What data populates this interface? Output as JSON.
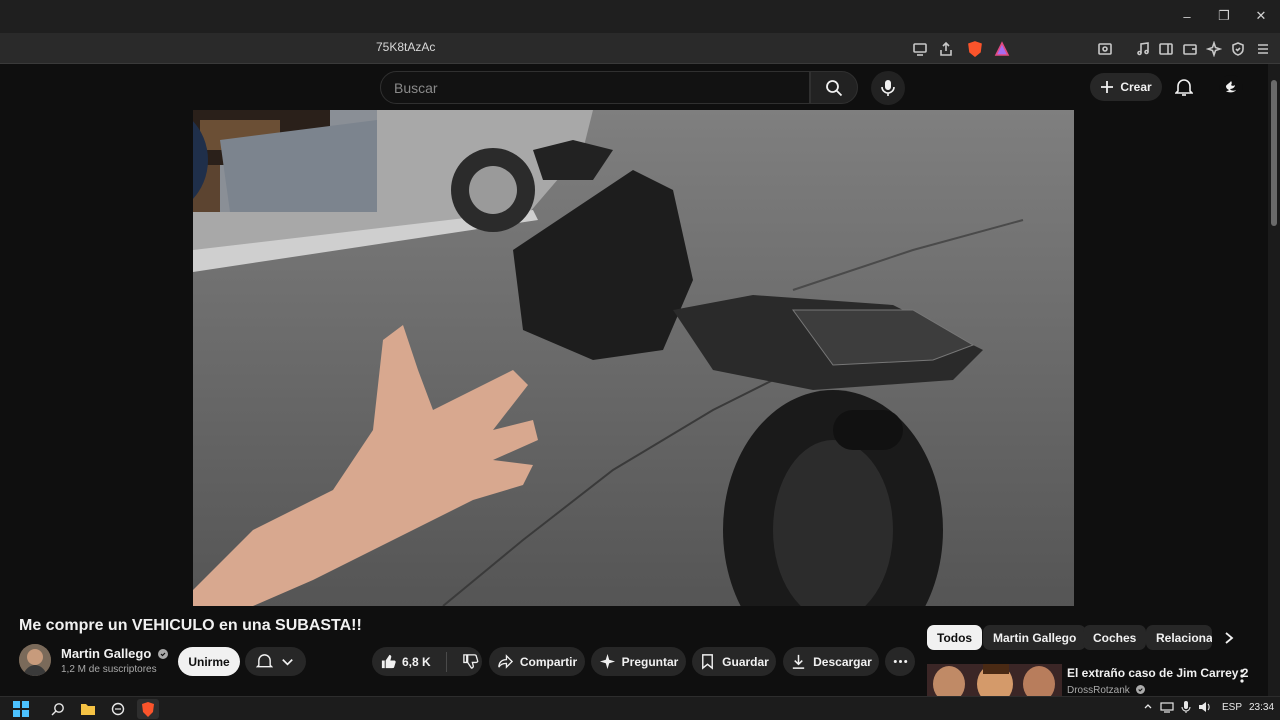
{
  "window": {
    "minimize": "–",
    "restore": "❐",
    "close": "✕"
  },
  "browser": {
    "url_fragment": "75K8tAzAc",
    "toolbar_icons": [
      "screen-cast-icon",
      "share-icon",
      "brave-shields-icon",
      "brave-rewards-icon",
      "tab-search-icon",
      "media-icon",
      "sidebar-icon",
      "wallet-icon",
      "leo-ai-icon",
      "vpn-icon",
      "menu-icon"
    ]
  },
  "header": {
    "search_placeholder": "Buscar",
    "create_label": "Crear"
  },
  "video": {
    "title": "Me compre un VEHICULO en una SUBASTA!!"
  },
  "channel": {
    "name": "Martin Gallego",
    "subscribers": "1,2 M de suscriptores",
    "join_label": "Unirme"
  },
  "actions": {
    "likes": "6,8 K",
    "share": "Compartir",
    "ask": "Preguntar",
    "save": "Guardar",
    "download": "Descargar"
  },
  "chips": [
    "Todos",
    "Martin Gallego",
    "Coches",
    "Relacionado"
  ],
  "related": {
    "title": "El extraño caso de Jim Carrey 2",
    "channel": "DrossRotzank"
  },
  "taskbar": {
    "language": "ESP",
    "time": "23:34"
  },
  "colors": {
    "background": "#0f0f0f",
    "pill": "#272727",
    "text": "#f1f1f1",
    "accent_red": "#ff0000"
  }
}
